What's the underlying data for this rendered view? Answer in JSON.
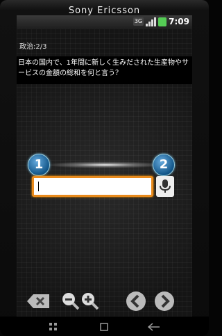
{
  "device": {
    "brand": "Sony Ericsson"
  },
  "statusbar": {
    "network": "3G",
    "time": "7:09"
  },
  "quiz": {
    "counter": "政治:2/3",
    "question": "日本の国内で、1年間に新しく生みだされた生産物やサービスの金額の総和を何と言う？"
  },
  "answer": {
    "badge_1": "1",
    "badge_2": "2",
    "input_value": ""
  },
  "colors": {
    "accent": "#e88a1c",
    "badge": "#1a6a9a"
  },
  "icons": {
    "backspace": "backspace-icon",
    "zoom_out": "zoom-out-icon",
    "zoom_in": "zoom-in-icon",
    "prev": "chevron-left-icon",
    "next": "chevron-right-icon",
    "mic": "mic-icon",
    "nav_menu": "grid-icon",
    "nav_home": "square-icon",
    "nav_back": "back-arrow-icon"
  }
}
